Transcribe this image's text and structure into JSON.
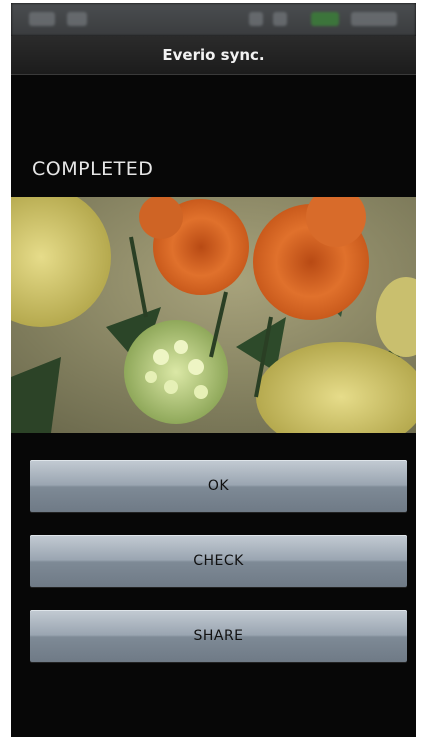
{
  "app": {
    "title": "Everio sync."
  },
  "main": {
    "heading": "COMPLETED"
  },
  "buttons": {
    "ok": "OK",
    "check": "CHECK",
    "share": "SHARE"
  },
  "colors": {
    "screen_background": "#070707",
    "title_bar": "#222222",
    "button_gradient_top": "#c3cbd3",
    "button_gradient_bottom": "#6f7a86"
  }
}
